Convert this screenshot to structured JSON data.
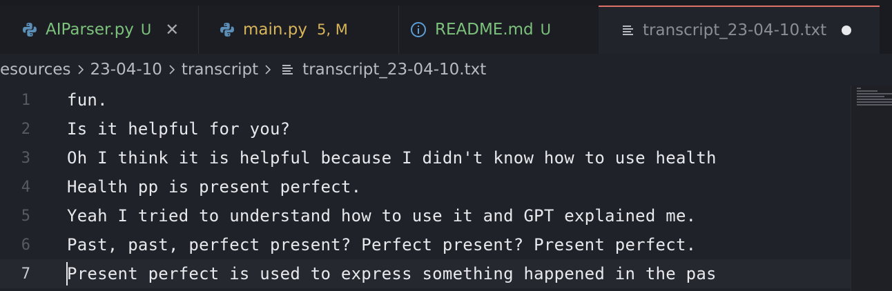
{
  "tabs": [
    {
      "label": "AIParser.py",
      "badge": "U",
      "icon": "python-icon",
      "color": "#7cc27c",
      "badge_color": "#7cc27c",
      "closable": true
    },
    {
      "label": "main.py",
      "badge": "5, M",
      "icon": "python-icon",
      "color": "#d8b45a",
      "badge_color": "#d8b45a"
    },
    {
      "label": "README.md",
      "badge": "U",
      "icon": "info-icon",
      "color": "#7cc27c",
      "badge_color": "#7cc27c"
    },
    {
      "label": "transcript_23-04-10.txt",
      "icon": "text-file-icon",
      "color": "#8c8e95",
      "active": true,
      "modified": true
    }
  ],
  "breadcrumb": {
    "items": [
      "esources",
      "23-04-10",
      "transcript"
    ],
    "file": "transcript_23-04-10.txt"
  },
  "editor": {
    "current_line": 7,
    "lines": [
      {
        "num": "1",
        "text": "fun."
      },
      {
        "num": "2",
        "text": "Is it helpful for you?"
      },
      {
        "num": "3",
        "text": "Oh I think it is helpful because I didn't know how to use health"
      },
      {
        "num": "4",
        "text": "Health pp is present perfect."
      },
      {
        "num": "5",
        "text": "Yeah I tried to understand how to use it and GPT explained me."
      },
      {
        "num": "6",
        "text": "Past, past, perfect present? Perfect present? Present perfect."
      },
      {
        "num": "7",
        "text": "Present perfect is used to express something happened in the pas"
      }
    ]
  },
  "colors": {
    "active_tab_border": "#e0736a",
    "editor_bg": "#20222a",
    "untracked": "#7cc27c",
    "modified": "#d8b45a"
  }
}
